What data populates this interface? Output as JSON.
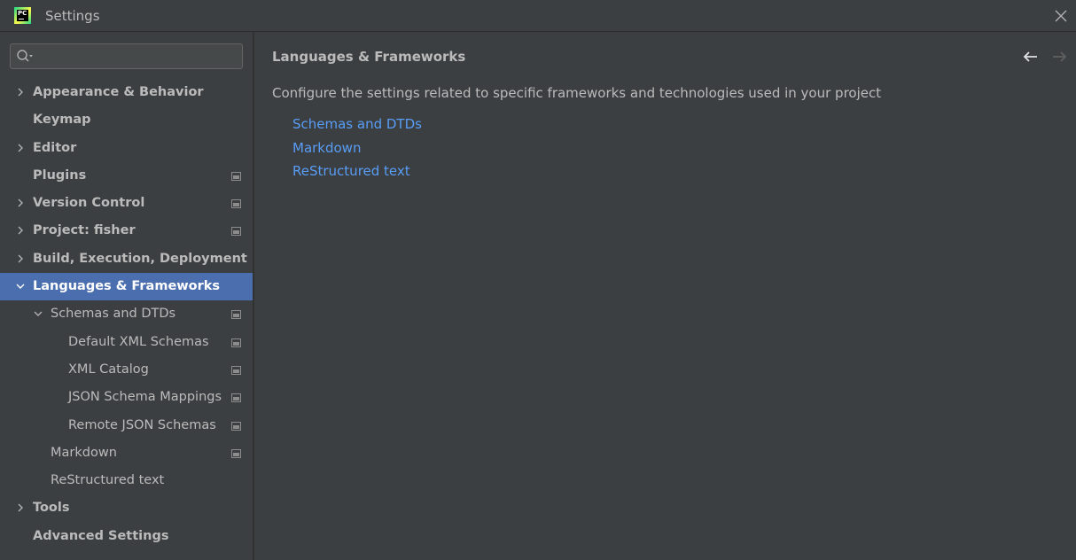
{
  "window": {
    "title": "Settings",
    "logo_text": "PC"
  },
  "search": {
    "placeholder": "",
    "value": ""
  },
  "sidebar": {
    "items": [
      {
        "label": "Appearance & Behavior"
      },
      {
        "label": "Keymap"
      },
      {
        "label": "Editor"
      },
      {
        "label": "Plugins"
      },
      {
        "label": "Version Control"
      },
      {
        "label": "Project: fisher"
      },
      {
        "label": "Build, Execution, Deployment"
      },
      {
        "label": "Languages & Frameworks"
      },
      {
        "label": "Schemas and DTDs"
      },
      {
        "label": "Default XML Schemas"
      },
      {
        "label": "XML Catalog"
      },
      {
        "label": "JSON Schema Mappings"
      },
      {
        "label": "Remote JSON Schemas"
      },
      {
        "label": "Markdown"
      },
      {
        "label": "ReStructured text"
      },
      {
        "label": "Tools"
      },
      {
        "label": "Advanced Settings"
      }
    ]
  },
  "main": {
    "title": "Languages & Frameworks",
    "description": "Configure the settings related to specific frameworks and technologies used in your project",
    "links": [
      "Schemas and DTDs",
      "Markdown",
      "ReStructured text"
    ]
  },
  "icons": {
    "logo": "pycharm-logo-icon",
    "close": "close-icon",
    "search": "search-icon",
    "back": "arrow-left-icon",
    "forward": "arrow-right-icon",
    "project_level": "project-level-icon",
    "expand": "chevron-right-icon",
    "collapse": "chevron-down-icon"
  },
  "colors": {
    "background": "#3c3f41",
    "selection": "#4b6eaf",
    "link": "#589df6",
    "text": "#bbbbbb"
  }
}
